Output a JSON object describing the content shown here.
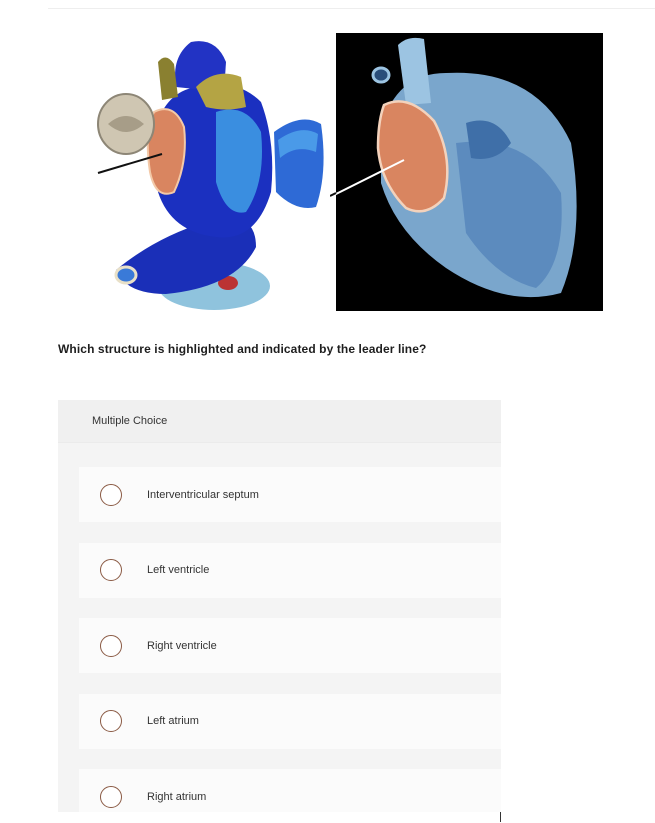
{
  "question": {
    "text": "Which structure is highlighted and indicated by the leader line?"
  },
  "answer_panel": {
    "header": "Multiple Choice",
    "options": [
      {
        "label": "Interventricular septum"
      },
      {
        "label": "Left ventricle"
      },
      {
        "label": "Right ventricle"
      },
      {
        "label": "Left atrium"
      },
      {
        "label": "Right atrium"
      }
    ]
  },
  "colors": {
    "highlight": "#d98560",
    "model_blue": "#1b2fb0",
    "radio_border": "#8a5a44"
  }
}
